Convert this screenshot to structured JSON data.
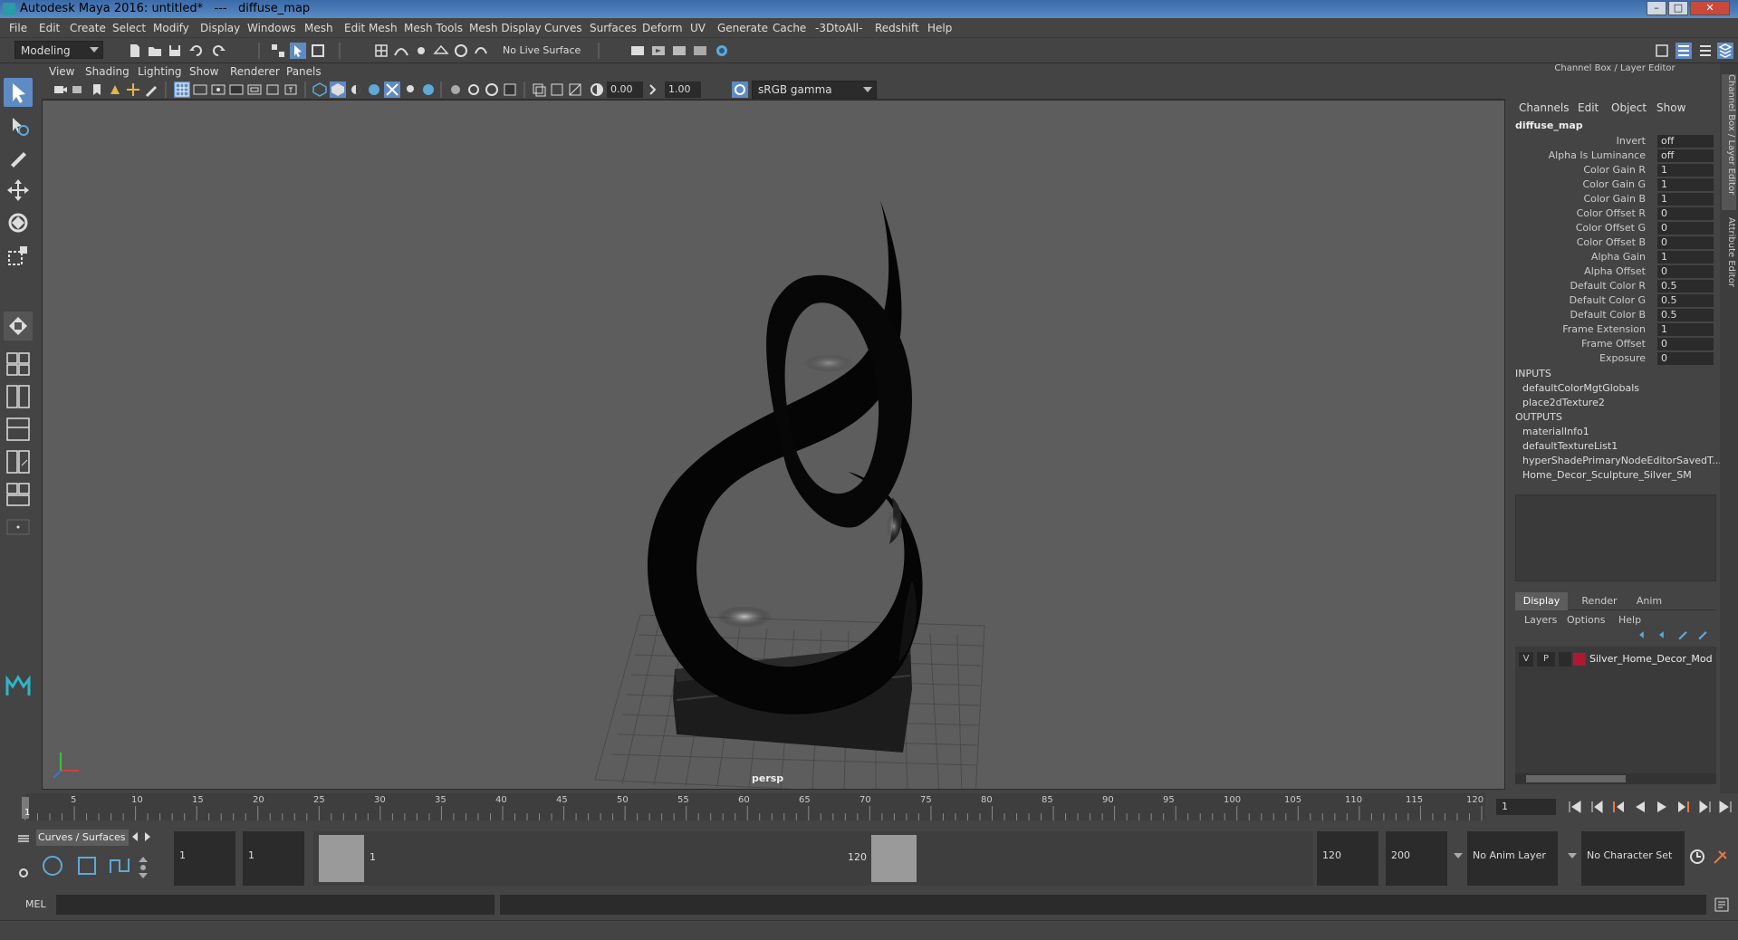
{
  "window": {
    "title": "Autodesk Maya 2016: untitled*   ---   diffuse_map",
    "buttons": [
      "–",
      "□",
      "✕"
    ]
  },
  "menubar": [
    "File",
    "Edit",
    "Create",
    "Select",
    "Modify",
    "Display",
    "Windows",
    "Mesh",
    "Edit Mesh",
    "Mesh Tools",
    "Mesh Display",
    "Curves",
    "Surfaces",
    "Deform",
    "UV",
    "Generate",
    "Cache",
    "-3DtoAll-",
    "Redshift",
    "Help"
  ],
  "statusline": {
    "mode": "Modeling",
    "live_surface": "No Live Surface"
  },
  "viewport": {
    "menu": [
      "View",
      "Shading",
      "Lighting",
      "Show",
      "Renderer",
      "Panels"
    ],
    "exposure": "0.00",
    "gamma": "1.00",
    "color_space": "sRGB gamma",
    "camera_label": "persp"
  },
  "channel_box": {
    "title": "Channel Box / Layer Editor",
    "menu": [
      "Channels",
      "Edit",
      "Object",
      "Show"
    ],
    "node_name": "diffuse_map",
    "attributes": [
      {
        "label": "Invert",
        "value": "off"
      },
      {
        "label": "Alpha Is Luminance",
        "value": "off"
      },
      {
        "label": "Color Gain R",
        "value": "1"
      },
      {
        "label": "Color Gain G",
        "value": "1"
      },
      {
        "label": "Color Gain B",
        "value": "1"
      },
      {
        "label": "Color Offset R",
        "value": "0"
      },
      {
        "label": "Color Offset G",
        "value": "0"
      },
      {
        "label": "Color Offset B",
        "value": "0"
      },
      {
        "label": "Alpha Gain",
        "value": "1"
      },
      {
        "label": "Alpha Offset",
        "value": "0"
      },
      {
        "label": "Default Color R",
        "value": "0.5"
      },
      {
        "label": "Default Color G",
        "value": "0.5"
      },
      {
        "label": "Default Color B",
        "value": "0.5"
      },
      {
        "label": "Frame Extension",
        "value": "1"
      },
      {
        "label": "Frame Offset",
        "value": "0"
      },
      {
        "label": "Exposure",
        "value": "0"
      }
    ],
    "inputs_label": "INPUTS",
    "inputs": [
      "defaultColorMgtGlobals",
      "place2dTexture2"
    ],
    "outputs_label": "OUTPUTS",
    "outputs": [
      "materialInfo1",
      "defaultTextureList1",
      "hyperShadePrimaryNodeEditorSavedT...",
      "Home_Decor_Sculpture_Silver_SM"
    ]
  },
  "layer_editor": {
    "tabs": [
      "Display",
      "Render",
      "Anim"
    ],
    "menu": [
      "Layers",
      "Options",
      "Help"
    ],
    "layer": {
      "v": "V",
      "p": "P",
      "name": "Silver_Home_Decor_Mod",
      "color": "#b01830"
    }
  },
  "side_tabs": [
    "Channel Box / Layer Editor",
    "Attribute Editor"
  ],
  "timeline": {
    "ticks": [
      "1",
      "5",
      "10",
      "15",
      "20",
      "25",
      "30",
      "35",
      "40",
      "45",
      "50",
      "55",
      "60",
      "65",
      "70",
      "75",
      "80",
      "85",
      "90",
      "95",
      "100",
      "105",
      "110",
      "115",
      "120"
    ],
    "current_frame": "1"
  },
  "range": {
    "shelf_tab": "Curves / Surfaces",
    "start": "1",
    "playback_start": "1",
    "slider_start": "1",
    "slider_end": "120",
    "playback_end": "120",
    "end": "200",
    "anim_layer": "No Anim Layer",
    "character_set": "No Character Set"
  },
  "cmdline": {
    "label": "MEL"
  },
  "colors": {
    "accent": "#5e8bc4",
    "viewport_bg": "#5d5d5d",
    "panel_bg": "#444444"
  }
}
